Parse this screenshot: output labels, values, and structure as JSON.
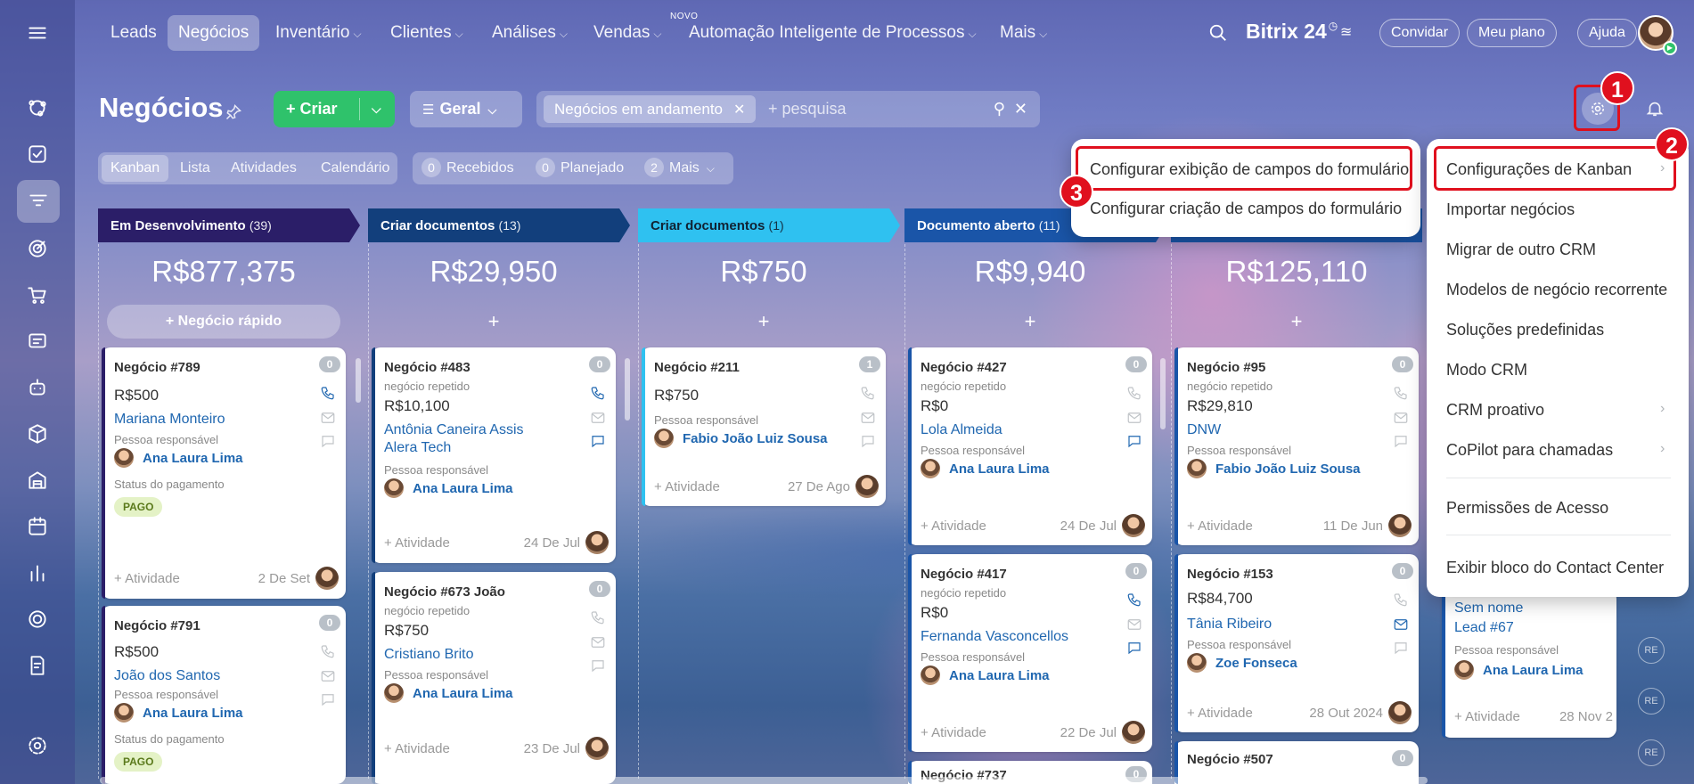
{
  "nav": {
    "items": [
      {
        "label": "Leads",
        "chev": ""
      },
      {
        "label": "Negócios",
        "chev": ""
      },
      {
        "label": "Inventário",
        "chev": "⌵"
      },
      {
        "label": "Clientes",
        "chev": "⌵"
      },
      {
        "label": "Análises",
        "chev": "⌵"
      },
      {
        "label": "Vendas",
        "chev": "⌵"
      },
      {
        "label": "Automação Inteligente de Processos",
        "chev": "⌵"
      },
      {
        "label": "Mais",
        "chev": "⌵"
      }
    ],
    "novo_badge": "NOVO",
    "brand": "Bitrix 24",
    "invite": "Convidar",
    "plan": "Meu plano",
    "help": "Ajuda"
  },
  "header": {
    "title": "Negócios",
    "create": "Criar",
    "general": "Geral",
    "filter_chip": "Negócios em andamento",
    "search_placeholder": "+ pesquisa"
  },
  "view_tabs": [
    "Kanban",
    "Lista",
    "Atividades",
    "Calendário"
  ],
  "counters": [
    {
      "n": "0",
      "label": "Recebidos"
    },
    {
      "n": "0",
      "label": "Planejado"
    },
    {
      "n": "2",
      "label": "Mais"
    }
  ],
  "columns": [
    {
      "title": "Em Desenvolvimento",
      "count": "(39)",
      "sum": "R$877,375",
      "color": "#2b1e68",
      "add": "+ Negócio rápido"
    },
    {
      "title": "Criar documentos",
      "count": "(13)",
      "sum": "R$29,950",
      "color": "#123f7c",
      "add": "+"
    },
    {
      "title": "Criar documentos",
      "count": "(1)",
      "sum": "R$750",
      "color": "#2fc1f0",
      "add": "+"
    },
    {
      "title": "Documento aberto",
      "count": "(11)",
      "sum": "R$9,940",
      "color": "#1a55a8",
      "add": "+"
    },
    {
      "title": "",
      "count": "",
      "sum": "R$125,110",
      "color": "#1a55a8",
      "add": "+"
    }
  ],
  "cards": {
    "c789": {
      "title": "Negócio #789",
      "badge": "0",
      "amount": "R$500",
      "contact": "Mariana Monteiro",
      "resp_label": "Pessoa responsável",
      "user": "Ana Laura Lima",
      "pay_label": "Status do pagamento",
      "tag": "PAGO",
      "activity": "+ Atividade",
      "date": "2 De Set"
    },
    "c791": {
      "title": "Negócio #791",
      "badge": "0",
      "amount": "R$500",
      "contact": "João dos Santos",
      "resp_label": "Pessoa responsável",
      "user": "Ana Laura Lima",
      "pay_label": "Status do pagamento",
      "tag": "PAGO"
    },
    "c483": {
      "title": "Negócio #483",
      "badge": "0",
      "sub": "negócio repetido",
      "amount": "R$10,100",
      "contact": "Antônia Caneira Assis",
      "contact2": "Alera Tech",
      "resp_label": "Pessoa responsável",
      "user": "Ana Laura Lima",
      "activity": "+ Atividade",
      "date": "24 De Jul"
    },
    "c673": {
      "title": "Negócio #673 João",
      "badge": "0",
      "sub": "negócio repetido",
      "amount": "R$750",
      "contact": "Cristiano Brito",
      "resp_label": "Pessoa responsável",
      "user": "Ana Laura Lima",
      "activity": "+ Atividade",
      "date": "23 De Jul"
    },
    "c211": {
      "title": "Negócio #211",
      "badge": "1",
      "amount": "R$750",
      "resp_label": "Pessoa responsável",
      "user": "Fabio João Luiz Sousa",
      "activity": "+ Atividade",
      "date": "27 De Ago"
    },
    "c427": {
      "title": "Negócio #427",
      "badge": "0",
      "sub": "negócio repetido",
      "amount": "R$0",
      "contact": "Lola Almeida",
      "resp_label": "Pessoa responsável",
      "user": "Ana Laura Lima",
      "activity": "+ Atividade",
      "date": "24 De Jul"
    },
    "c417": {
      "title": "Negócio #417",
      "badge": "0",
      "sub": "negócio repetido",
      "amount": "R$0",
      "contact": "Fernanda Vasconcellos",
      "resp_label": "Pessoa responsável",
      "user": "Ana Laura Lima",
      "activity": "+ Atividade",
      "date": "22 De Jul"
    },
    "c737": {
      "title": "Negócio #737",
      "badge": "0"
    },
    "c95": {
      "title": "Negócio #95",
      "badge": "0",
      "sub": "negócio repetido",
      "amount": "R$29,810",
      "contact": "DNW",
      "resp_label": "Pessoa responsável",
      "user": "Fabio João Luiz Sousa",
      "activity": "+ Atividade",
      "date": "11 De Jun"
    },
    "c153": {
      "title": "Negócio #153",
      "badge": "0",
      "amount": "R$84,700",
      "contact": "Tânia Ribeiro",
      "resp_label": "Pessoa responsável",
      "user": "Zoe Fonseca",
      "activity": "+ Atividade",
      "date": "28 Out 2024"
    },
    "c507": {
      "title": "Negócio #507",
      "badge": "0"
    },
    "cL67": {
      "contact": "Sem nome",
      "contact2": "Lead #67",
      "resp_label": "Pessoa responsável",
      "user": "Ana Laura Lima",
      "activity": "+ Atividade",
      "date": "28 Nov 2"
    }
  },
  "menu": {
    "items": [
      {
        "label": "Configurações de Kanban",
        "arrow": "›"
      },
      {
        "label": "Importar negócios",
        "arrow": ""
      },
      {
        "label": "Migrar de outro CRM",
        "arrow": ""
      },
      {
        "label": "Modelos de negócio recorrente",
        "arrow": ""
      },
      {
        "label": "Soluções predefinidas",
        "arrow": ""
      },
      {
        "label": "Modo CRM",
        "arrow": ""
      },
      {
        "label": "CRM proativo",
        "arrow": "›"
      },
      {
        "label": "CoPilot para chamadas",
        "arrow": "›"
      },
      {
        "label": "Permissões de Acesso",
        "arrow": ""
      },
      {
        "label": "Exibir bloco do Contact Center",
        "arrow": ""
      }
    ],
    "submenu": [
      "Configurar exibição de campos do formulário",
      "Configurar criação de campos do formulário"
    ]
  },
  "steps": [
    "1",
    "2",
    "3"
  ],
  "avatars_right": [
    "RE",
    "RE",
    "RE",
    "RE"
  ],
  "colors": {
    "accent_red": "#e0101e",
    "create_green": "#2fc26b",
    "link_blue": "#2067b0"
  }
}
